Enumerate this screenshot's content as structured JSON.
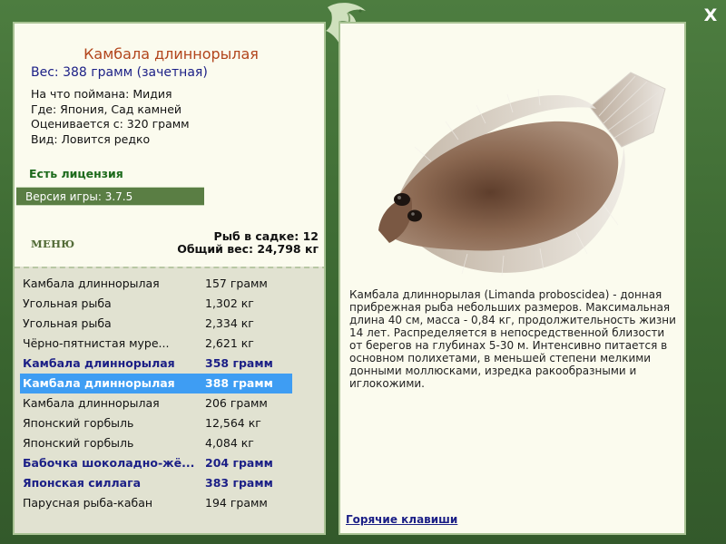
{
  "fish": {
    "title": "Камбала длиннорылая",
    "weight_line": "Вес: 388 грамм (зачетная)",
    "info_lines": [
      "На что поймана: Мидия",
      "Где: Япония, Сад камней",
      "Оценивается с: 320 грамм",
      "Вид: Ловится редко"
    ],
    "description": "Камбала длиннорылая (Limanda proboscidea) - донная прибрежная рыба небольших размеров. Максимальная длина 40 см, масса - 0,84 кг, продолжительность жизни 14 лет. Распределяется в непосредственной близости от берегов на глубинах 5-30 м. Интенсивно питается в основном полихетами, в меньшей степени мелкими донными моллюсками, изредка ракообразными и иглокожими."
  },
  "license": "Есть лицензия",
  "version": "Версия игры: 3.7.5",
  "menu_label": "МЕНЮ",
  "keepnet": {
    "count": "Рыб в садке: 12",
    "total": "Общий вес: 24,798 кг"
  },
  "catch_list": [
    {
      "name": "Камбала длиннорылая",
      "weight": "157 грамм",
      "style": "normal"
    },
    {
      "name": "Угольная рыба",
      "weight": "1,302 кг",
      "style": "normal"
    },
    {
      "name": "Угольная рыба",
      "weight": "2,334 кг",
      "style": "normal"
    },
    {
      "name": "Чёрно-пятнистая муре...",
      "weight": "2,621 кг",
      "style": "normal"
    },
    {
      "name": "Камбала длиннорылая",
      "weight": "358 грамм",
      "style": "bold"
    },
    {
      "name": "Камбала длиннорылая",
      "weight": "388 грамм",
      "style": "selected"
    },
    {
      "name": "Камбала длиннорылая",
      "weight": "206 грамм",
      "style": "normal"
    },
    {
      "name": "Японский горбыль",
      "weight": "12,564 кг",
      "style": "normal"
    },
    {
      "name": "Японский горбыль",
      "weight": "4,084 кг",
      "style": "normal"
    },
    {
      "name": "Бабочка шоколадно-жё...",
      "weight": "204 грамм",
      "style": "bold"
    },
    {
      "name": "Японская силлага",
      "weight": "383 грамм",
      "style": "bold"
    },
    {
      "name": "Парусная рыба-кабан",
      "weight": "194 грамм",
      "style": "normal"
    }
  ],
  "hotkeys": "Горячие клавиши",
  "close_glyph": "X",
  "colors": {
    "background": "#3d6a33",
    "panel": "#fbfbee",
    "title": "#b2451c",
    "navy": "#1b1f86",
    "selected": "#3e9df3"
  }
}
